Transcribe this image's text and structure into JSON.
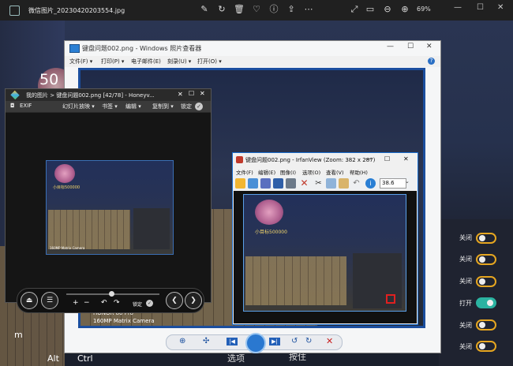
{
  "topbar": {
    "filename": "微信图片_20230420203554.jpg",
    "zoom": "69%",
    "icons": [
      "app-icon",
      "edit-icon",
      "rotate-icon",
      "delete-icon",
      "favorite-icon",
      "info-icon",
      "share-icon",
      "more-icon",
      "fullscreen-icon",
      "fit-icon",
      "zoom-out-icon",
      "zoom-in-icon"
    ]
  },
  "background_photo": {
    "number_text": "50",
    "keyboard_keys": [
      "m",
      "Alt",
      "Ctrl",
      "⟨",
      "⟩",
      "选项",
      "按住"
    ],
    "toggles": [
      {
        "label": "关闭",
        "state": "off"
      },
      {
        "label": "关闭",
        "state": "off"
      },
      {
        "label": "关闭",
        "state": "off"
      },
      {
        "label": "打开",
        "state": "on"
      },
      {
        "label": "关闭",
        "state": "off"
      },
      {
        "label": "关闭",
        "state": "off"
      }
    ],
    "phone_lines": [
      "HONOR 80 Pro",
      "160MP Matrix Camera"
    ]
  },
  "photo_viewer": {
    "title": "键盘问题002.png - Windows 照片查看器",
    "menu": [
      "文件(F) ▾",
      "打印(P) ▾",
      "电子邮件(E)",
      "刻录(U) ▾",
      "打开(O) ▾"
    ],
    "help": "?",
    "bottom_buttons": [
      "zoom-icon",
      "fit-icon",
      "prev-icon",
      "slideshow-icon",
      "next-icon",
      "rotate-left-icon",
      "rotate-right-icon",
      "delete-icon"
    ]
  },
  "honeyview": {
    "title": "我的图片 > 键盘问题002.png [42/78] - Honeyv...",
    "toolbar": [
      "EXIF",
      "幻灯片放映 ▾",
      "书签 ▾",
      "编辑 ▾",
      "复制到 ▾",
      "锁定"
    ],
    "controls": [
      "+",
      "−",
      "↶",
      "↷",
      "锁定"
    ]
  },
  "irfanview": {
    "title": "键盘问题002.png - IrfanView (Zoom: 382 x 287)",
    "menu": [
      "文件(F)",
      "编辑(E)",
      "图像(I)",
      "选项(O)",
      "查看(V)",
      "帮助(H)"
    ],
    "zoom_value": "38.6",
    "thumb_text": "小目标500000"
  },
  "thumb_honeyview_text": "小目标500000",
  "thumb_phone_text": "160MP Matrix Camera",
  "colors": {
    "accent_blue": "#1b6fd0",
    "toggle_on": "#2bb3a1",
    "toggle_border": "#e6a620"
  }
}
